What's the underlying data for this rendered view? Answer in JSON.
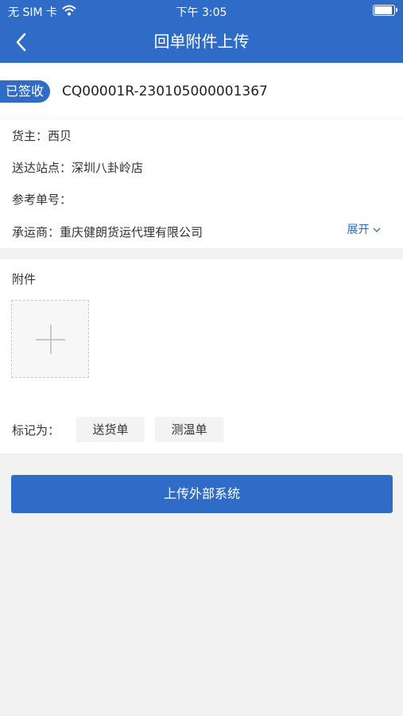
{
  "status_bar": {
    "carrier": "无 SIM 卡",
    "time": "下午 3:05",
    "battery_level": 0.85
  },
  "nav": {
    "back_icon": "chevron-left-icon",
    "title": "回单附件上传"
  },
  "document": {
    "status_badge": "已签收",
    "number": "CQ00001R-230105000001367"
  },
  "info": {
    "owner_label": "货主：",
    "owner_value": "西贝",
    "station_label": "送达站点：",
    "station_value": "深圳八卦岭店",
    "ref_label": "参考单号：",
    "ref_value": "",
    "carrier_label": "承运商：",
    "carrier_value": "重庆健朗货运代理有限公司",
    "expand_label": "展开"
  },
  "attachments": {
    "title": "附件",
    "add_icon": "plus-icon"
  },
  "mark": {
    "label": "标记为：",
    "tags": [
      "送货单",
      "测温单"
    ]
  },
  "submit_label": "上传外部系统",
  "colors": {
    "primary": "#2e6cc7"
  }
}
